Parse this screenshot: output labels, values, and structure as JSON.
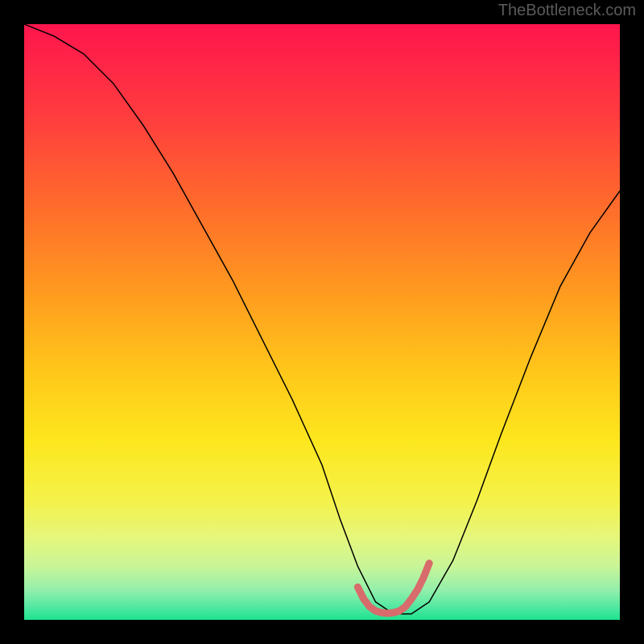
{
  "watermark": "TheBottleneck.com",
  "chart_data": {
    "type": "line",
    "title": "",
    "xlabel": "",
    "ylabel": "",
    "xlim": [
      0,
      100
    ],
    "ylim": [
      0,
      100
    ],
    "series": [
      {
        "name": "bottleneck-curve",
        "x": [
          0,
          5,
          10,
          15,
          20,
          25,
          30,
          35,
          40,
          45,
          50,
          53,
          56,
          59,
          62,
          65,
          68,
          72,
          76,
          80,
          85,
          90,
          95,
          100
        ],
        "y": [
          100,
          98,
          95,
          90,
          83,
          75,
          66,
          57,
          47,
          37,
          26,
          17,
          9,
          3,
          1,
          1,
          3,
          10,
          20,
          31,
          44,
          56,
          65,
          72
        ],
        "color": "#000000",
        "stroke_width": 1.5
      },
      {
        "name": "optimal-marker",
        "x": [
          56,
          57,
          58,
          59,
          60,
          61,
          62,
          63,
          64,
          65,
          66,
          67,
          68
        ],
        "y": [
          5.5,
          3.5,
          2.2,
          1.5,
          1.2,
          1.1,
          1.2,
          1.5,
          2.2,
          3.5,
          5.0,
          7.0,
          9.5
        ],
        "color": "#d86b6b",
        "stroke_width": 9
      }
    ],
    "background_gradient": {
      "type": "vertical",
      "stops": [
        {
          "offset": 0,
          "color": "#ff154d"
        },
        {
          "offset": 15,
          "color": "#ff3b3f"
        },
        {
          "offset": 30,
          "color": "#ff6a2c"
        },
        {
          "offset": 45,
          "color": "#ff9a1f"
        },
        {
          "offset": 58,
          "color": "#ffc61a"
        },
        {
          "offset": 70,
          "color": "#fde71e"
        },
        {
          "offset": 80,
          "color": "#f4f24a"
        },
        {
          "offset": 86,
          "color": "#e6f67a"
        },
        {
          "offset": 91,
          "color": "#c9f598"
        },
        {
          "offset": 95,
          "color": "#93efab"
        },
        {
          "offset": 98,
          "color": "#4ee8a1"
        },
        {
          "offset": 100,
          "color": "#1de28e"
        }
      ]
    }
  }
}
